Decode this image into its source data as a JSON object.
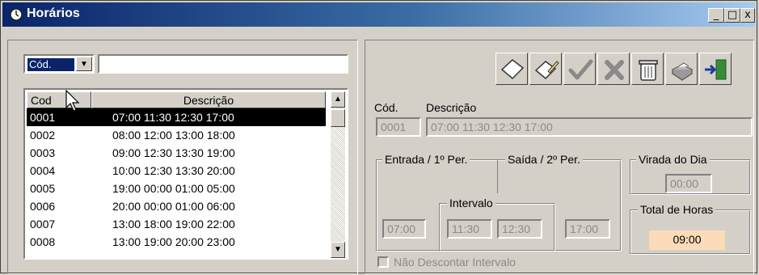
{
  "window": {
    "title": "Horários",
    "buttons": {
      "minimize": "_",
      "maximize": "□",
      "close": "x"
    }
  },
  "search": {
    "field_selected": "Cód.",
    "value": ""
  },
  "list": {
    "headers": {
      "code": "Cod",
      "description": "Descrição"
    },
    "rows": [
      {
        "code": "0001",
        "description": "07:00 11:30 12:30 17:00",
        "selected": true
      },
      {
        "code": "0002",
        "description": "08:00 12:00 13:00 18:00"
      },
      {
        "code": "0003",
        "description": "09:00 12:30 13:30 19:00"
      },
      {
        "code": "0004",
        "description": "10:00 12:30 13:30 20:00"
      },
      {
        "code": "0005",
        "description": "19:00 00:00 01:00 05:00"
      },
      {
        "code": "0006",
        "description": "20:00 00:00 01:00 06:00"
      },
      {
        "code": "0007",
        "description": "13:00 18:00 19:00 22:00"
      },
      {
        "code": "0008",
        "description": "13:00 19:00 20:00 23:00"
      }
    ]
  },
  "toolbar": {
    "icons": [
      "new-icon",
      "edit-icon",
      "confirm-icon",
      "cancel-icon",
      "delete-icon",
      "print-icon",
      "exit-icon"
    ]
  },
  "form": {
    "code_label": "Cód.",
    "code_value": "0001",
    "description_label": "Descrição",
    "description_value": "07:00 11:30 12:30 17:00",
    "entrada_label": "Entrada / 1º Per.",
    "saida_label": "Saída / 2º Per.",
    "intervalo_label": "Intervalo",
    "entrada_value": "07:00",
    "intervalo_start": "11:30",
    "intervalo_end": "12:30",
    "saida_value": "17:00",
    "virada_label": "Virada do Dia",
    "virada_value": "00:00",
    "total_label": "Total de Horas",
    "total_value": "09:00",
    "nao_descontar_label": "Não Descontar Intervalo"
  },
  "colors": {
    "title_bar": "#0a246a",
    "selection": "#000000",
    "total_bg": "#fcdcb8",
    "confirm_green": "#4c9a3c",
    "cancel_gray": "#8a8a8a"
  }
}
